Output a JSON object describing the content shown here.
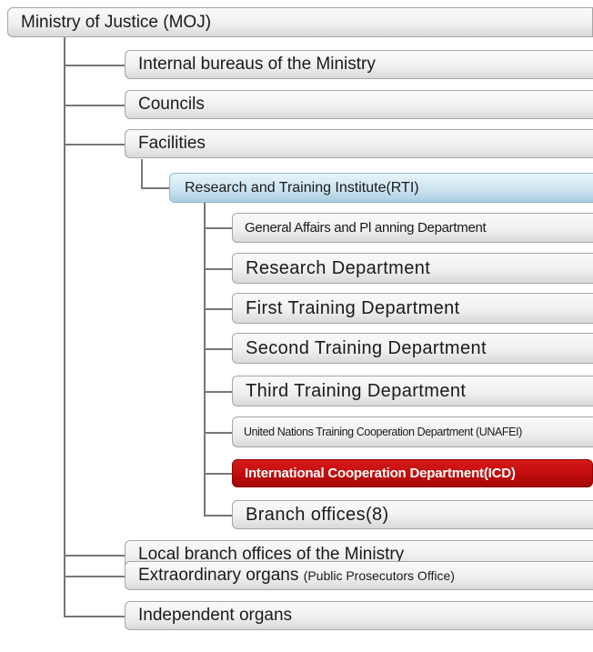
{
  "root": {
    "label": "Ministry of Justice (MOJ)"
  },
  "level2": [
    {
      "label": "Internal bureaus of the Ministry"
    },
    {
      "label": "Councils"
    },
    {
      "label": "Facilities"
    }
  ],
  "rti": {
    "label": "Research and Training Institute(RTI)"
  },
  "departments": [
    {
      "label": "General Affairs and Pl anning Department"
    },
    {
      "label": "Research Department"
    },
    {
      "label": "First Training Department"
    },
    {
      "label": "Second Training Department"
    },
    {
      "label": "Third Training Department"
    },
    {
      "label": "United Nations Training Cooperation Department (UNAFEI)"
    },
    {
      "label": "International Cooperation Department(ICD)",
      "highlight": true
    },
    {
      "label": "Branch offices(8)"
    }
  ],
  "level2_after": [
    {
      "label": "Local branch offices of the Ministry"
    },
    {
      "label": "Extraordinary organs",
      "sublabel": "(Public Prosecutors Office)"
    },
    {
      "label": "Independent organs"
    }
  ],
  "colors": {
    "highlight": "#c20d0d",
    "rti": "#cde4f0",
    "node": "#eeeeee",
    "connector": "#777777"
  }
}
